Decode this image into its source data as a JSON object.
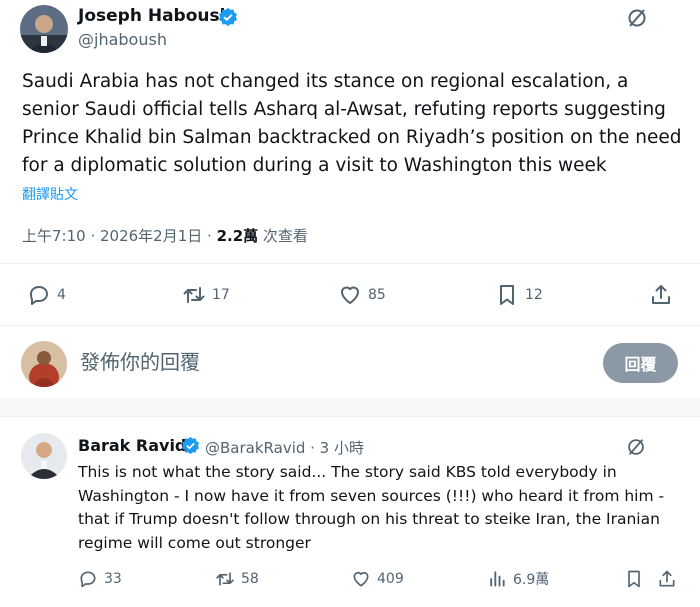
{
  "main_tweet": {
    "author_name": "Joseph Haboush",
    "author_handle": "@jhaboush",
    "text": "Saudi Arabia has not changed its stance on regional escalation, a senior Saudi official tells Asharq al-Awsat, refuting reports suggesting Prince Khalid bin Salman backtracked on Riyadh’s position on the need for a diplomatic solution during a visit to Washington this week",
    "translate_label": "翻譯貼文",
    "timestamp": "上午7:10 · 2026年2月1日 · ",
    "views_count": "2.2萬",
    "views_label": " 次查看",
    "replies": "4",
    "reposts": "17",
    "likes": "85",
    "bookmarks": "12"
  },
  "reply_composer": {
    "placeholder": "發佈你的回覆",
    "button_label": "回覆"
  },
  "reply_tweet": {
    "author_name": "Barak Ravid",
    "author_handle": "@BarakRavid · 3 小時",
    "text": "This is not what the story said... The story said KBS told everybody in Washington - I now have it from seven sources (!!!) who heard it from him - that if Trump doesn't follow through on his threat to steike Iran, the Iranian regime will come out stronger",
    "replies": "33",
    "reposts": "58",
    "likes": "409",
    "views": "6.9萬"
  },
  "colors": {
    "verified": "#1d9bf0",
    "link": "#1d9bf0",
    "secondary_text": "#536471",
    "reply_button": "#8b98a5"
  },
  "icons": [
    "verified-badge-icon",
    "grok-icon",
    "reply-icon",
    "repost-icon",
    "like-icon",
    "bookmark-icon",
    "share-icon",
    "views-icon"
  ]
}
